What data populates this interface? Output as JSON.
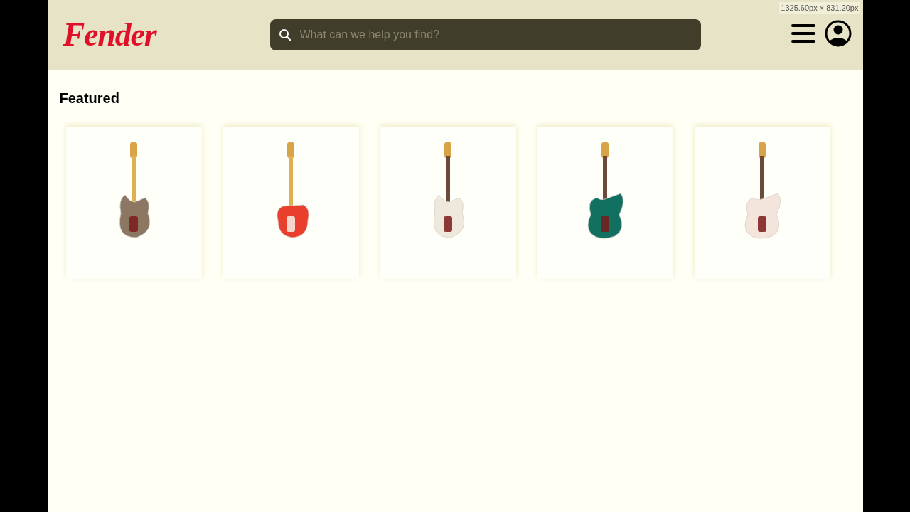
{
  "overlay": {
    "dimensions": "1325.60px × 831.20px"
  },
  "header": {
    "logo": "Fender",
    "search": {
      "placeholder": "What can we help you find?"
    }
  },
  "featured": {
    "title": "Featured",
    "products": [
      {
        "kind": "strat",
        "color": "#8c7862"
      },
      {
        "kind": "tele",
        "color": "#e8402c"
      },
      {
        "kind": "strat",
        "color": "#efe8dc"
      },
      {
        "kind": "offset",
        "color": "#127060"
      },
      {
        "kind": "offset",
        "color": "#f3e4dc"
      }
    ]
  }
}
